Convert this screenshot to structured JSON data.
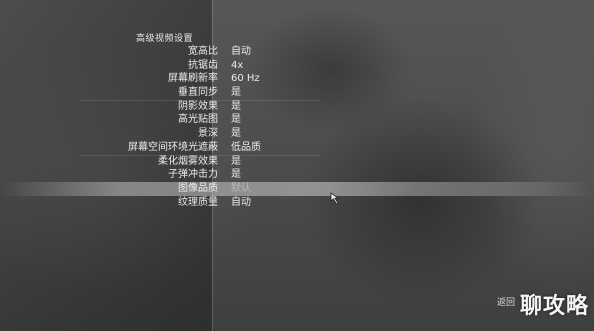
{
  "menu": {
    "title": "高级视频设置",
    "settings": [
      {
        "label": "宽高比",
        "value": "自动"
      },
      {
        "label": "抗锯齿",
        "value": "4x"
      },
      {
        "label": "屏幕刷新率",
        "value": "60 Hz"
      },
      {
        "label": "垂直同步",
        "value": "是"
      },
      {
        "label": "阴影效果",
        "value": "是"
      },
      {
        "label": "高光贴图",
        "value": "是"
      },
      {
        "label": "景深",
        "value": "是"
      },
      {
        "label": "屏幕空间环境光遮蔽",
        "value": "低品质"
      },
      {
        "label": "柔化烟雾效果",
        "value": "是"
      },
      {
        "label": "子弹冲击力",
        "value": "是"
      },
      {
        "label": "图像品质",
        "value": "默认"
      },
      {
        "label": "纹理质量",
        "value": "自动"
      }
    ]
  },
  "footer": {
    "back_label": "返回"
  },
  "watermark": {
    "text": "聊攻略"
  }
}
